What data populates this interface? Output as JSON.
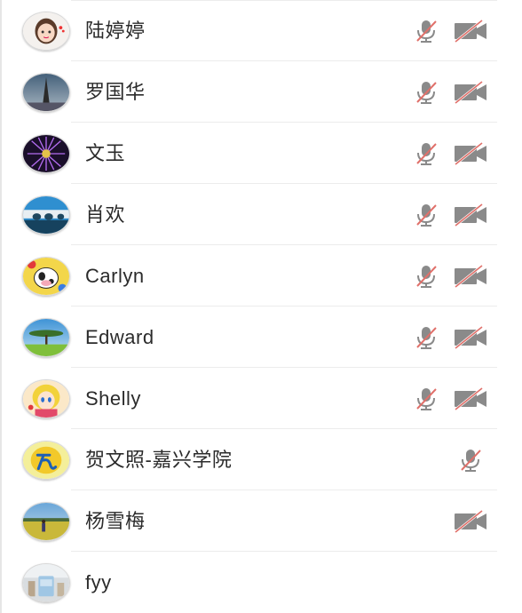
{
  "participants": [
    {
      "name": "陆婷婷",
      "avatar": "cartoon-girl-avatar",
      "mic": "muted",
      "camera": "off"
    },
    {
      "name": "罗国华",
      "avatar": "eiffel-tower-avatar",
      "mic": "muted",
      "camera": "off"
    },
    {
      "name": "文玉",
      "avatar": "purple-flower-avatar",
      "mic": "muted",
      "camera": "off"
    },
    {
      "name": "肖欢",
      "avatar": "bridge-avatar",
      "mic": "muted",
      "camera": "off"
    },
    {
      "name": "Carlyn",
      "avatar": "cartoon-cow-avatar",
      "mic": "muted",
      "camera": "off"
    },
    {
      "name": "Edward",
      "avatar": "acacia-tree-avatar",
      "mic": "muted",
      "camera": "off"
    },
    {
      "name": "Shelly",
      "avatar": "anime-girl-avatar",
      "mic": "muted",
      "camera": "off"
    },
    {
      "name": "贺文照-嘉兴学院",
      "avatar": "yellow-logo-avatar",
      "mic": "muted",
      "camera": null
    },
    {
      "name": "杨雪梅",
      "avatar": "flower-field-avatar",
      "mic": null,
      "camera": "off"
    },
    {
      "name": "fyy",
      "avatar": "room-photo-avatar",
      "mic": null,
      "camera": null
    }
  ],
  "colors": {
    "icon_gray": "#8a8a8a",
    "slash_red": "#e0706a",
    "divider": "#ececec",
    "text": "#2b2b2b"
  }
}
